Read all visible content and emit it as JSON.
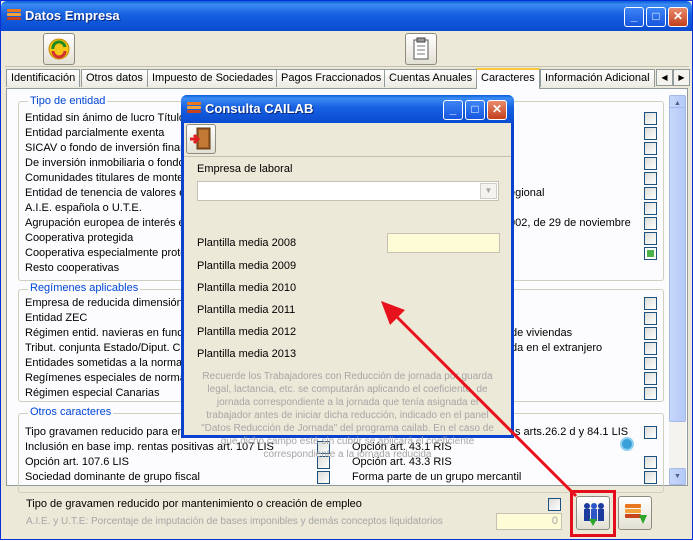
{
  "window": {
    "title": "Datos Empresa"
  },
  "tabs": [
    "Identificación",
    "Otros datos",
    "Impuesto de Sociedades",
    "Pagos Fraccionados",
    "Cuentas Anuales",
    "Caracteres",
    "Información Adicional"
  ],
  "groups": {
    "tipo_entidad": {
      "legend": "Tipo de entidad",
      "items": [
        "Entidad sin ánimo de lucro Título",
        "Entidad parcialmente exenta",
        "SICAV o fondo de inversión finan",
        "De inversión inmobiliaria o fondo d",
        "Comunidades titulares de montes",
        "Entidad de tenencia de valores e",
        "A.I.E. española o U.T.E.",
        "Agrupación europea de interés ec",
        "Cooperativa protegida",
        "Cooperativa especialmente proteg",
        "Resto cooperativas"
      ],
      "right_fragments": [
        "egional",
        "002, de 29 de noviembre"
      ]
    },
    "regimenes": {
      "legend": "Regímenes aplicables",
      "items": [
        "Empresa de reducida dimensión",
        "Entidad ZEC",
        "Régimen entid. navieras en funci",
        "Tribut. conjunta Estado/Diput. Co",
        "Entidades sometidas a la normativ",
        "Regímenes especiales de normal",
        "Régimen especial Canarias"
      ],
      "right_fragments": [
        "de viviendas",
        "da en el extranjero"
      ]
    },
    "otros": {
      "legend": "Otros caracteres",
      "left": [
        "Tipo gravamen reducido para ent",
        "Inclusión en base imp. rentas positivas art. 107 LIS",
        "Opción art. 107.6 LIS",
        "Sociedad dominante de grupo fiscal"
      ],
      "right": [
        "s arts.26.2 d y 84.1 LIS",
        "Opción art. 43.1 RIS",
        "Opción art. 43.3 RIS",
        "Forma parte de un grupo mercantil"
      ]
    }
  },
  "bottom": {
    "label1": "Tipo de gravamen reducido por mantenimiento o creación de empleo",
    "label2": "A.I.E. y U.T.E: Porcentaje de imputación de bases imponibles y demás conceptos liquidatorios",
    "value": "0"
  },
  "dialog": {
    "title": "Consulta CAILAB",
    "empresa_label": "Empresa de laboral",
    "empresa_value": "",
    "plantillas": [
      "Plantilla media 2008",
      "Plantilla media 2009",
      "Plantilla media 2010",
      "Plantilla media 2011",
      "Plantilla media 2012",
      "Plantilla media 2013"
    ],
    "note": "Recuerde los Trabajadores con Reducción de jornada por guarda legal, lactancia, etc. se computarán aplicando el coeficiente, de jornada correspondiente a la jornada que tenía asignada el trabajador antes de iniciar dicha reducción, indicado en el panel \"Datos Reducción de Jornada\" del programa cailab. En el caso de que dicho campo esté sin cubrir se aplicará el coeficiente correspondiente a la jornada reducida"
  },
  "colors": {
    "accent_red": "#e40d1b",
    "titlebar": "#0a4bd0",
    "legend": "#0046d5"
  }
}
